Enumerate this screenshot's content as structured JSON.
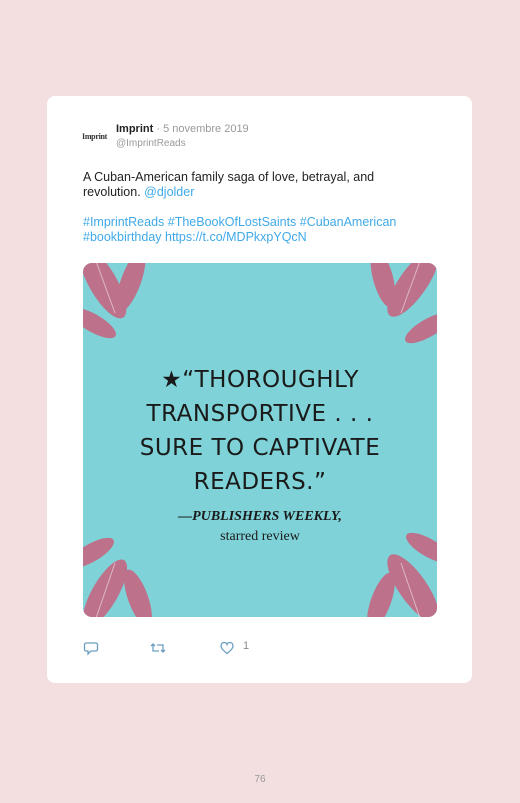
{
  "tweet": {
    "avatar_text": "Imprint",
    "name": "Imprint",
    "separator": " · ",
    "date": "5 novembre 2019",
    "handle": "@ImprintReads",
    "text": "A Cuban-American family saga of love, betrayal, and revolution. ",
    "mention": "@djolder",
    "hashtags_line1": "#ImprintReads #TheBookOfLostSaints #CubanAmerican",
    "hashtags_line2": "#bookbirthday https://t.co/MDPkxpYQcN",
    "image": {
      "quote_line1": "★“THOROUGHLY",
      "quote_line2": "TRANSPORTIVE . . .",
      "quote_line3": "SURE TO CAPTIVATE",
      "quote_line4": "READERS.”",
      "attribution": "—PUBLISHERS WEEKLY,",
      "attribution2": "starred review",
      "bg_color": "#7fd3d8",
      "leaf_color": "#c9607c"
    },
    "actions": {
      "reply_icon": "reply-icon",
      "retweet_icon": "retweet-icon",
      "like_icon": "heart-icon",
      "like_count": "1"
    }
  },
  "page_number": "76"
}
